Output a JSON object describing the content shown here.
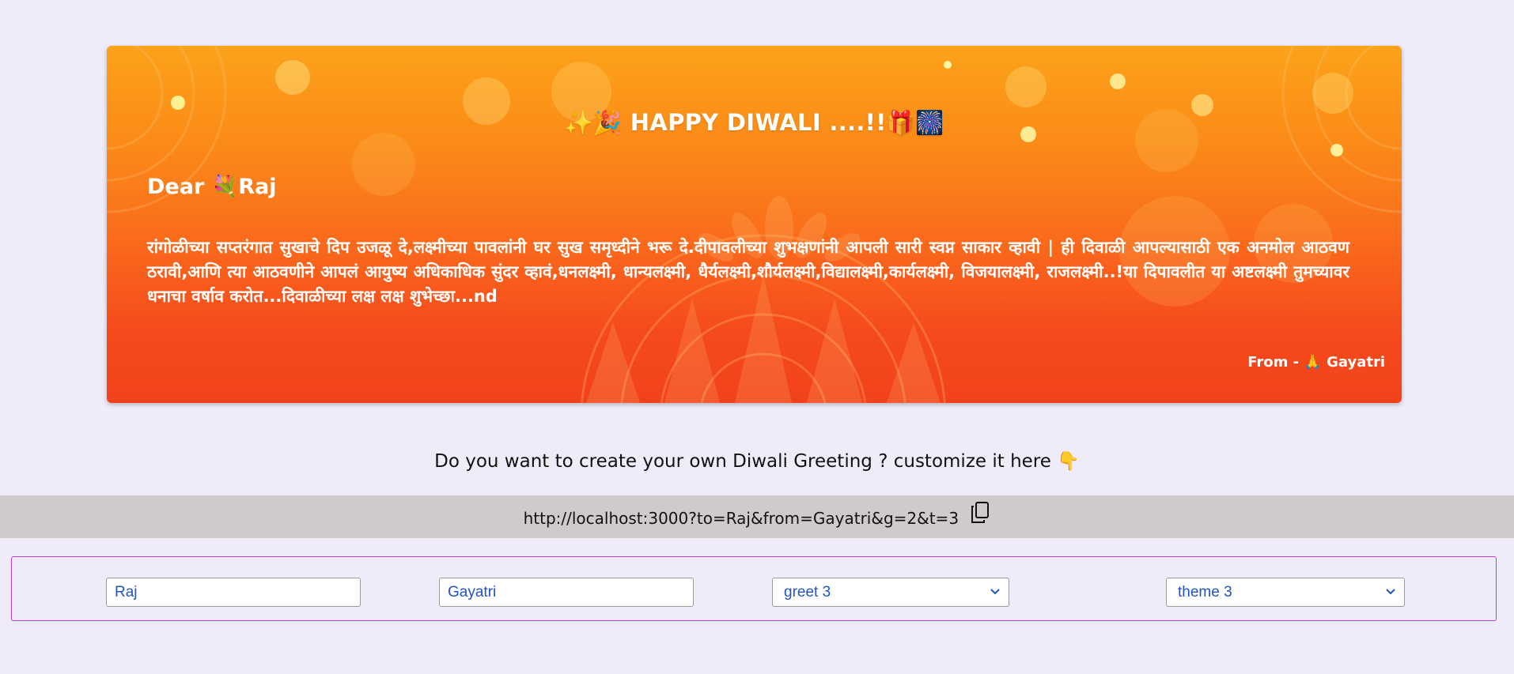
{
  "card": {
    "title_prefix_emoji": "✨🎉",
    "title_text": "HAPPY DIWALI ....!!",
    "title_suffix_emoji": "🎁🎆",
    "dear_prefix": "Dear",
    "dear_emoji": "💐",
    "to_name": "Raj",
    "message": "रांगोळीच्या सप्तरंगात सुखाचे दिप उजळू दे,लक्ष्मीच्या पावलांनी घर सुख समृध्दीने भरू दे.दीपावलीच्या शुभक्षणांनी आपली सारी स्वप्न साकार व्हावी | ही दिवाळी आपल्यासाठी एक अनमोल आठवण ठरावी,आणि त्या आठवणीने आपलं आयुष्य अधिकाधिक सुंदर व्हावं,धनलक्ष्मी, धान्यलक्ष्मी, धैर्यलक्ष्मी,शौर्यलक्ष्मी,विद्यालक्ष्मी,कार्यलक्ष्मी, विजयालक्ष्मी, राजलक्ष्मी..!या दिपावलीत या अष्टलक्ष्मी तुमच्यावर धनाचा वर्षाव करोत...दिवाळीच्या लक्ष लक्ष शुभेच्छा...nd",
    "from_prefix": "From -",
    "from_emoji": "🙏",
    "from_name": "Gayatri"
  },
  "prompt": {
    "text": "Do you want to create your own Diwali Greeting ? customize it here",
    "emoji": "👇"
  },
  "share": {
    "url": "http://localhost:3000?to=Raj&from=Gayatri&g=2&t=3",
    "copy_icon": "copy-icon"
  },
  "form": {
    "to_value": "Raj",
    "from_value": "Gayatri",
    "greet_selected": "greet 3",
    "theme_selected": "theme 3"
  },
  "colors": {
    "page_bg": "#efebf8",
    "card_top": "#fca21a",
    "card_bottom": "#f2421c",
    "url_bar_bg": "#cfcbcb",
    "form_border": "#b23fd6",
    "field_text": "#1f53c7"
  }
}
